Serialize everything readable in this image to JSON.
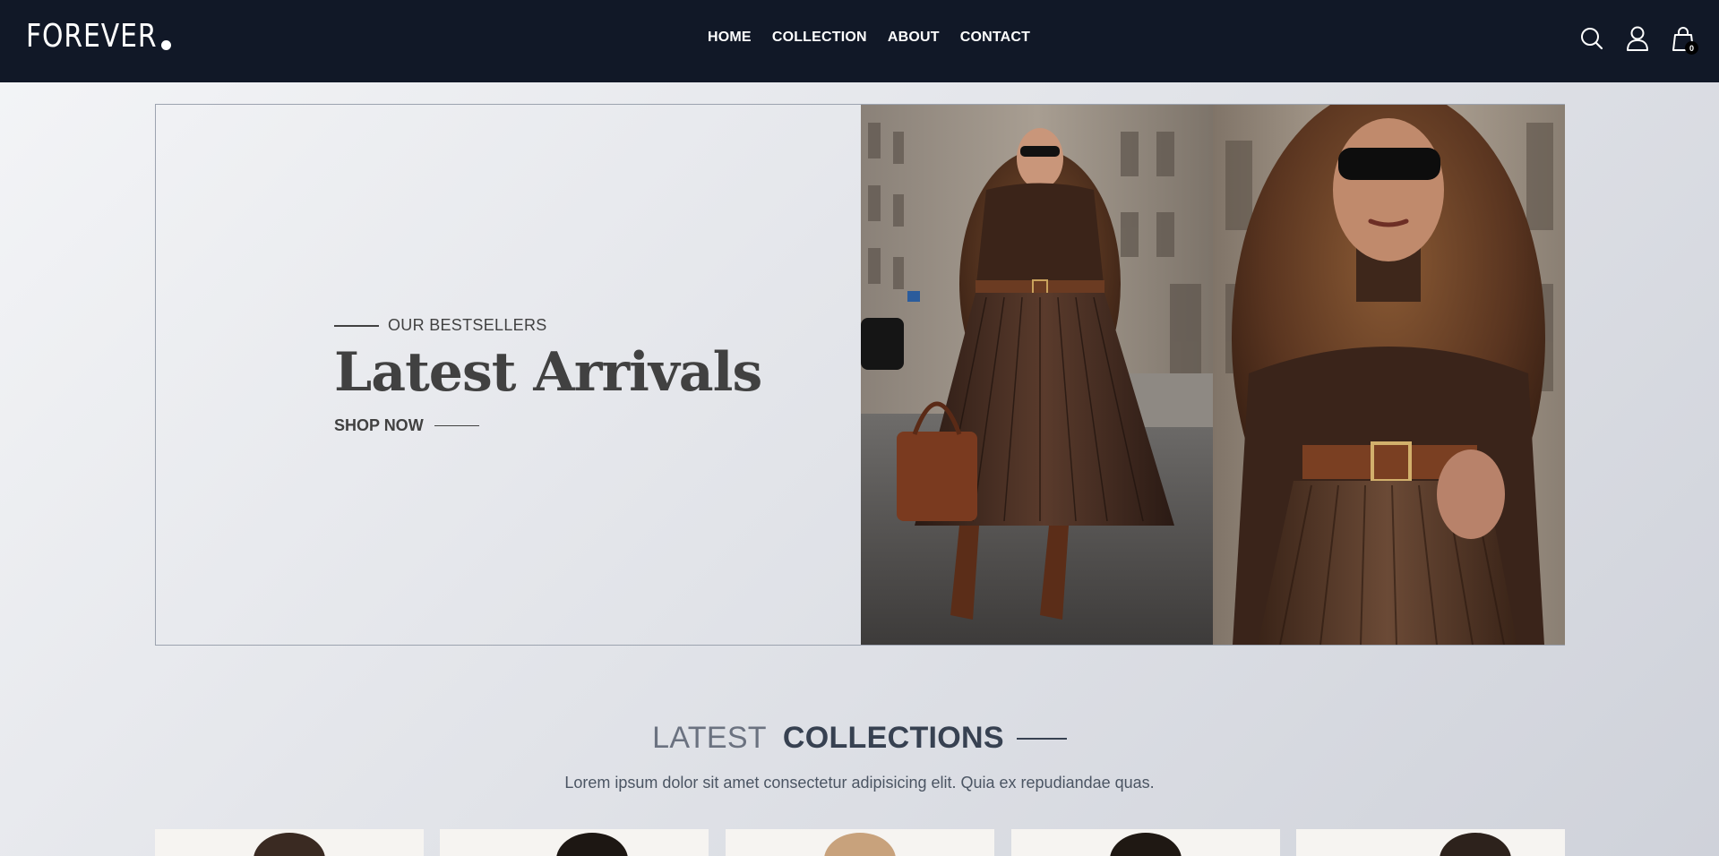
{
  "brand": {
    "name": "FOREVER"
  },
  "nav": {
    "links": [
      "HOME",
      "COLLECTION",
      "ABOUT",
      "CONTACT"
    ],
    "icons": [
      "search-icon",
      "profile-icon",
      "cart-icon"
    ],
    "cart_count": "0"
  },
  "hero": {
    "eyebrow": "OUR BESTSELLERS",
    "title": "Latest Arrivals",
    "cta": "SHOP NOW"
  },
  "latest": {
    "title_light": "LATEST",
    "title_bold": "COLLECTIONS",
    "subtitle": "Lorem ipsum dolor sit amet consectetur adipisicing elit. Quia ex repudiandae quas."
  },
  "colors": {
    "navbar": "#111827",
    "text_dark": "#414141",
    "title_gray": "#6b7280"
  }
}
